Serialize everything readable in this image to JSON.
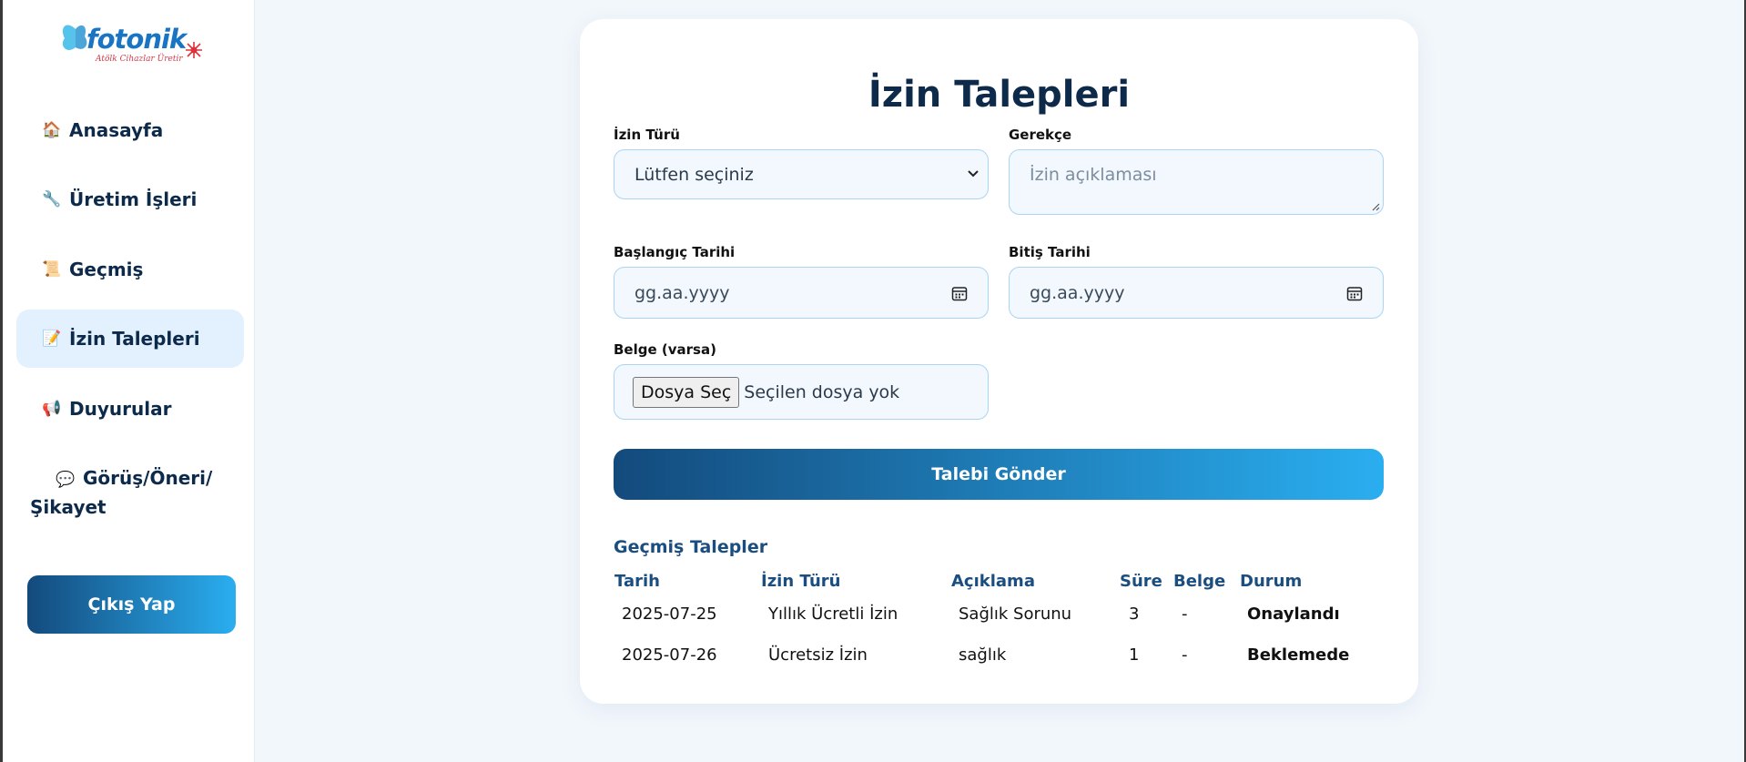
{
  "sidebar": {
    "logo_text": "fotonik",
    "logo_tagline": "Atölk Cihazlar Üretir",
    "items": [
      {
        "icon": "🏠",
        "icon_name": "home-icon",
        "label": "Anasayfa"
      },
      {
        "icon": "🔧",
        "icon_name": "wrench-icon",
        "label": "Üretim İşleri"
      },
      {
        "icon": "📜",
        "icon_name": "scroll-icon",
        "label": "Geçmiş"
      },
      {
        "icon": "📝",
        "icon_name": "memo-icon",
        "label": "İzin Talepleri",
        "active": true
      },
      {
        "icon": "📢",
        "icon_name": "megaphone-icon",
        "label": "Duyurular"
      },
      {
        "icon": "💬",
        "icon_name": "speech-bubble-icon",
        "label_line1": "Görüş/Öneri/",
        "label_line2": "Şikayet"
      }
    ],
    "logout_label": "Çıkış Yap"
  },
  "form": {
    "title": "İzin Talepleri",
    "leave_type_label": "İzin Türü",
    "leave_type_value": "Lütfen seçiniz",
    "reason_label": "Gerekçe",
    "reason_placeholder": "İzin açıklaması",
    "start_label": "Başlangıç Tarihi",
    "start_placeholder": "gg.aa.yyyy",
    "end_label": "Bitiş Tarihi",
    "end_placeholder": "gg.aa.yyyy",
    "doc_label": "Belge (varsa)",
    "file_button": "Dosya Seç",
    "file_status": "Seçilen dosya yok",
    "submit_label": "Talebi Gönder"
  },
  "history": {
    "title": "Geçmiş Talepler",
    "columns": [
      "Tarih",
      "İzin Türü",
      "Açıklama",
      "Süre",
      "Belge",
      "Durum"
    ],
    "rows": [
      [
        "2025-07-25",
        "Yıllık Ücretli İzin",
        "Sağlık Sorunu",
        "3",
        "-",
        "Onaylandı"
      ],
      [
        "2025-07-26",
        "Ücretsiz İzin",
        "sağlık",
        "1",
        "-",
        "Beklemede"
      ]
    ]
  },
  "colors": {
    "accent_dark": "#134a7c",
    "accent_light": "#2aaef0",
    "heading": "#0d2a4a",
    "active_nav_bg": "#e2f1fd"
  }
}
